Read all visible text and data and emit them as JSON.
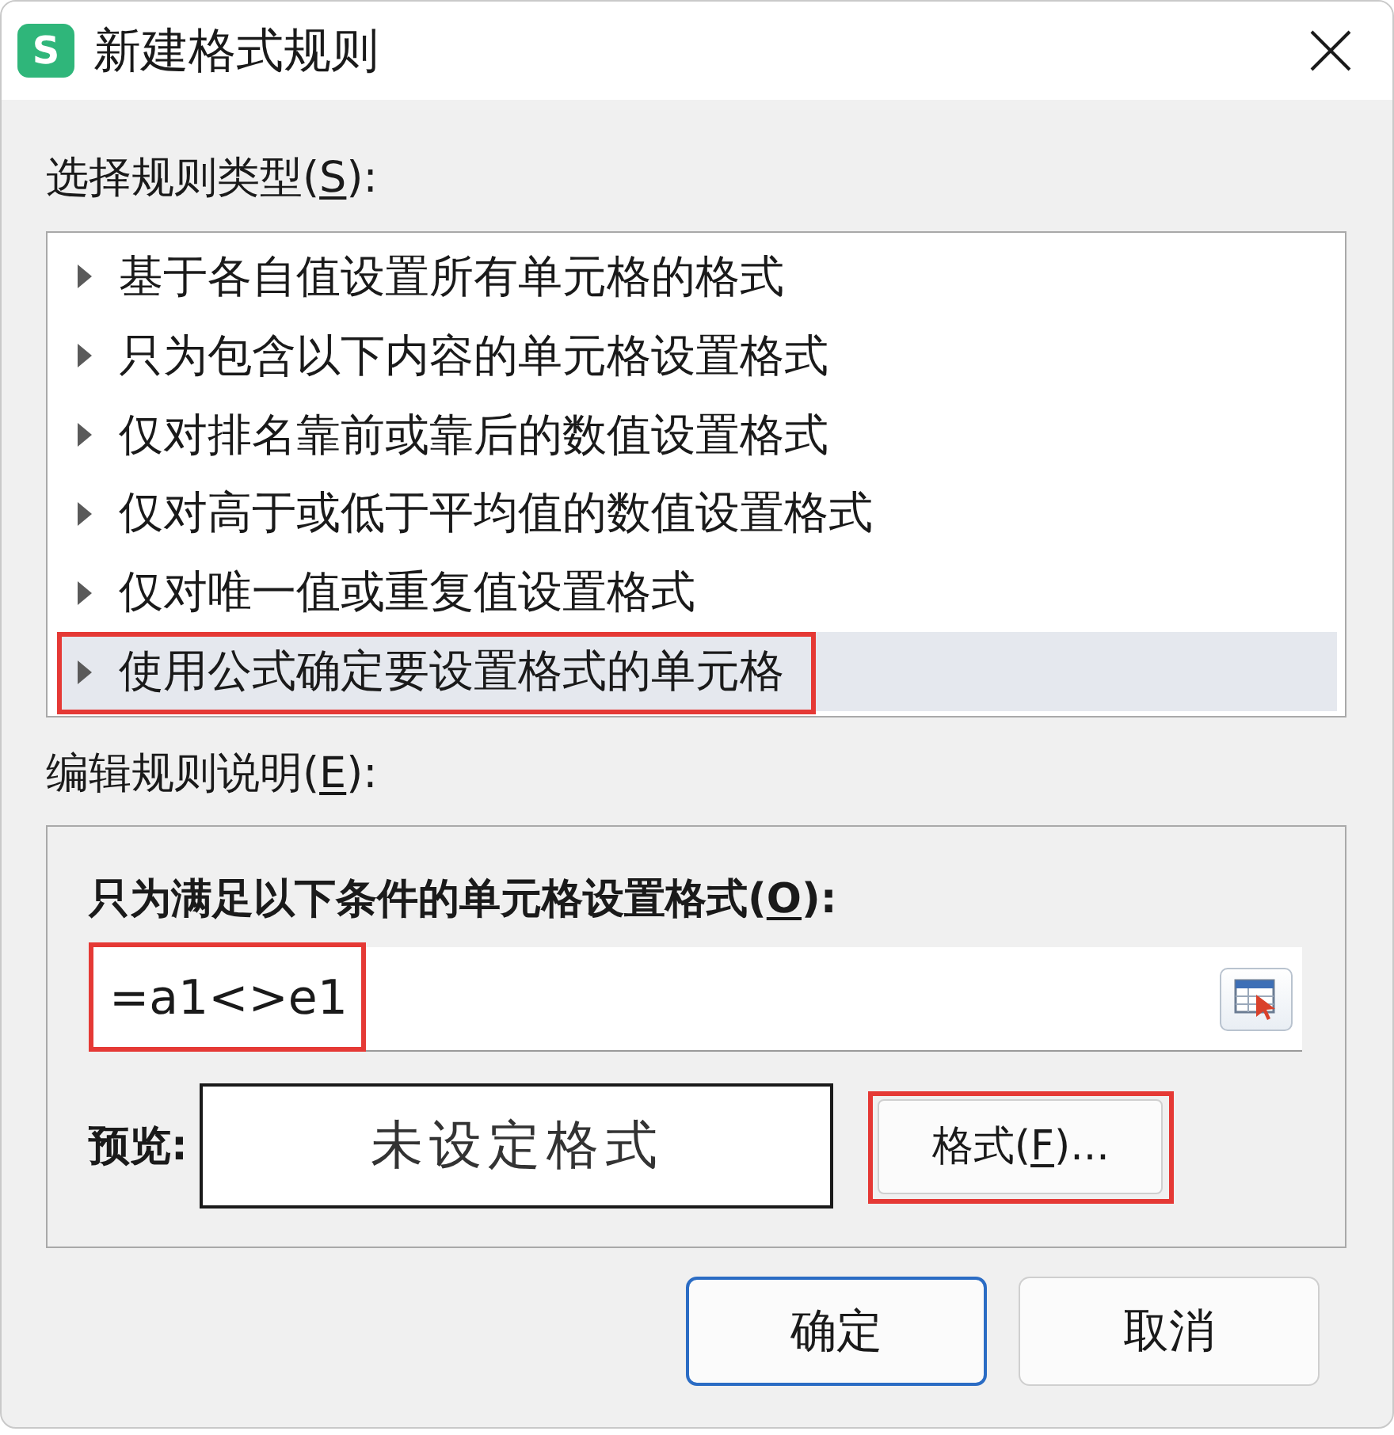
{
  "window": {
    "logo_letter": "S",
    "title": "新建格式规则"
  },
  "rule_type": {
    "label": {
      "before": "选择规则类型(",
      "key": "S",
      "after": "):"
    },
    "items": [
      {
        "text": "基于各自值设置所有单元格的格式",
        "selected": false,
        "highlighted": false
      },
      {
        "text": "只为包含以下内容的单元格设置格式",
        "selected": false,
        "highlighted": false
      },
      {
        "text": "仅对排名靠前或靠后的数值设置格式",
        "selected": false,
        "highlighted": false
      },
      {
        "text": "仅对高于或低于平均值的数值设置格式",
        "selected": false,
        "highlighted": false
      },
      {
        "text": "仅对唯一值或重复值设置格式",
        "selected": false,
        "highlighted": false
      },
      {
        "text": "使用公式确定要设置格式的单元格",
        "selected": true,
        "highlighted": true
      }
    ]
  },
  "description": {
    "label": {
      "before": "编辑规则说明(",
      "key": "E",
      "after": "):"
    },
    "condition_label": {
      "before": "只为满足以下条件的单元格设置格式(",
      "key": "O",
      "after": "):"
    },
    "formula": {
      "value": "=a1<>e1",
      "highlighted": true
    },
    "preview_label": "预览:",
    "preview_text": "未设定格式",
    "format_button": {
      "label": {
        "before": "格式(",
        "key": "F",
        "after": ")..."
      },
      "highlighted": true
    }
  },
  "buttons": [
    {
      "label": "确定",
      "default": true
    },
    {
      "label": "取消",
      "default": false
    }
  ]
}
